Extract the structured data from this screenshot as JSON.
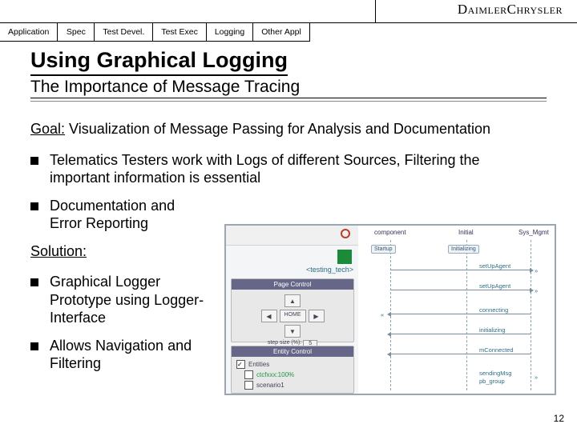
{
  "logo": "DaimlerChrysler",
  "tabs": [
    "Application",
    "Spec",
    "Test Devel.",
    "Test Exec",
    "Logging",
    "Other Appl"
  ],
  "title": "Using Graphical Logging",
  "subtitle": "The Importance of Message Tracing",
  "goal_label": "Goal:",
  "goal_text": " Visualization of Message Passing for Analysis and Documentation",
  "bullet1": "Telematics Testers work with Logs of different Sources, Filtering the important information is essential",
  "bullet2": "Documentation and Error Reporting",
  "solution_label": "Solution:",
  "bullet3": "Graphical Logger Prototype using Logger-Interface",
  "bullet4": "Allows Navigation and Filtering",
  "page_number": "12",
  "fig": {
    "tag": "<testing_tech>",
    "panel_page": "Page Control",
    "home": "HOME",
    "step": "step size (%):",
    "step_val": "5",
    "panel_entity": "Entity Control",
    "entity_root": "Entities",
    "entity_a": "ctcfxxx:100%",
    "entity_b": "scenario1",
    "col_comp": "component",
    "col_initial": "Initial",
    "col_sys": "Sys_Mgmt",
    "start1": "Startup",
    "start2": "Initializing",
    "msg_setup": "setUpAgent",
    "msg_setup2": "setUpAgent",
    "msg_connecting": "connecting",
    "msg_initial": "initializing",
    "msg_connect": "mConnected",
    "msg_group": "sendingMsg",
    "msg_group2": "pb_group"
  }
}
